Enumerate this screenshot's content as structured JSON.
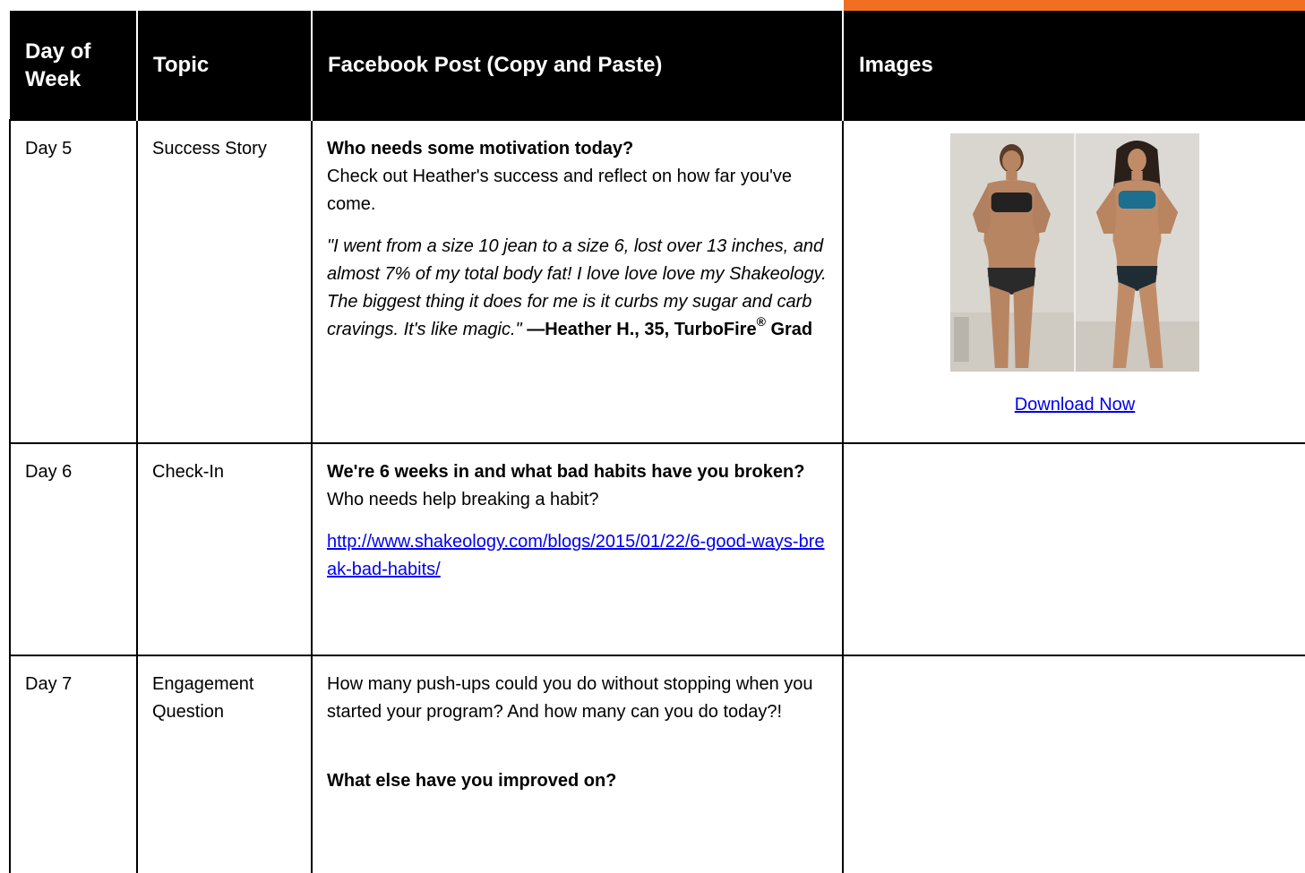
{
  "header": {
    "col_day": "Day of Week",
    "col_topic": "Topic",
    "col_post": "Facebook Post (Copy and Paste)",
    "col_images": "Images"
  },
  "rows": [
    {
      "day": "Day 5",
      "topic": "Success Story",
      "post_heading": "Who needs some motivation today?",
      "post_text": "Check out Heather's success and reflect on how far you've come.",
      "quote": "\"I went from a size 10 jean to a size 6, lost over 13 inches, and almost 7% of my total body fat! I love love love my Shakeology. The biggest thing it does for me is it curbs my sugar and carb cravings. It's like magic.\"",
      "attribution": "—Heather H., 35, TurboFire",
      "attribution_mark": "®",
      "attribution_end": " Grad",
      "image_link": "Download Now"
    },
    {
      "day": "Day 6",
      "topic": "Check-In",
      "post_heading": "We're 6 weeks in and what bad habits have you broken?",
      "post_text": "Who needs help breaking a habit?",
      "url": "http://www.shakeology.com/blogs/2015/01/22/6-good-ways-break-bad-habits/"
    },
    {
      "day": "Day 7",
      "topic": "Engagement Question",
      "post_text": "How many push-ups could you do without stopping when you started your program? And how many can you do today?!",
      "post_heading_after": "What else have you improved on?"
    }
  ],
  "colors": {
    "accent": "#f26f21",
    "header_bg": "#000000",
    "link": "#0000ee"
  }
}
